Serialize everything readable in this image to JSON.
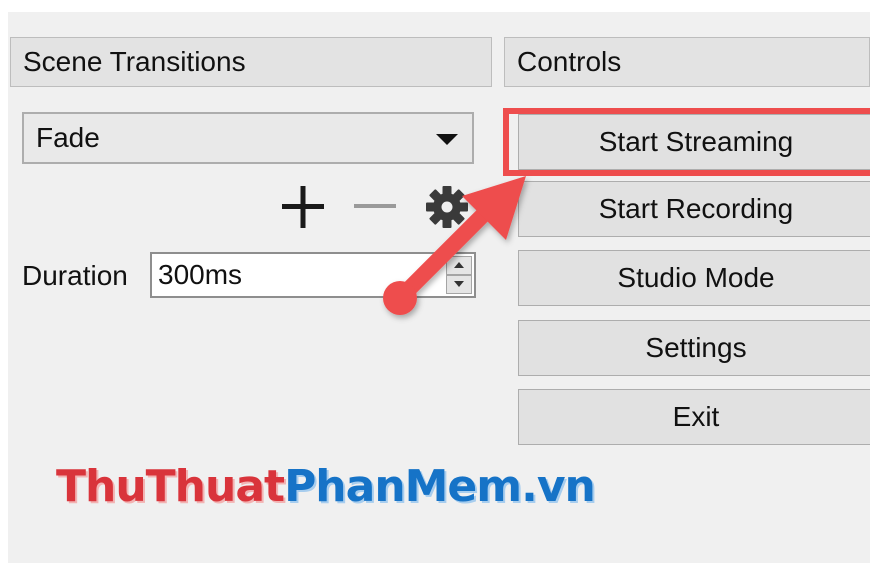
{
  "scene_transitions": {
    "header": "Scene Transitions",
    "selected_transition": "Fade",
    "tools": [
      "add-icon",
      "remove-icon",
      "gear-icon"
    ],
    "duration_label": "Duration",
    "duration_value": "300ms"
  },
  "controls": {
    "header": "Controls",
    "buttons": [
      {
        "label": "Start Streaming"
      },
      {
        "label": "Start Recording"
      },
      {
        "label": "Studio Mode"
      },
      {
        "label": "Settings"
      },
      {
        "label": "Exit"
      }
    ]
  },
  "annotation": {
    "highlight_color": "#ee4d4d"
  },
  "watermark": {
    "part1": "ThuThuat",
    "part2": "PhanMem.vn",
    "color_red": "#d9343b",
    "color_blue": "#1673c7"
  }
}
